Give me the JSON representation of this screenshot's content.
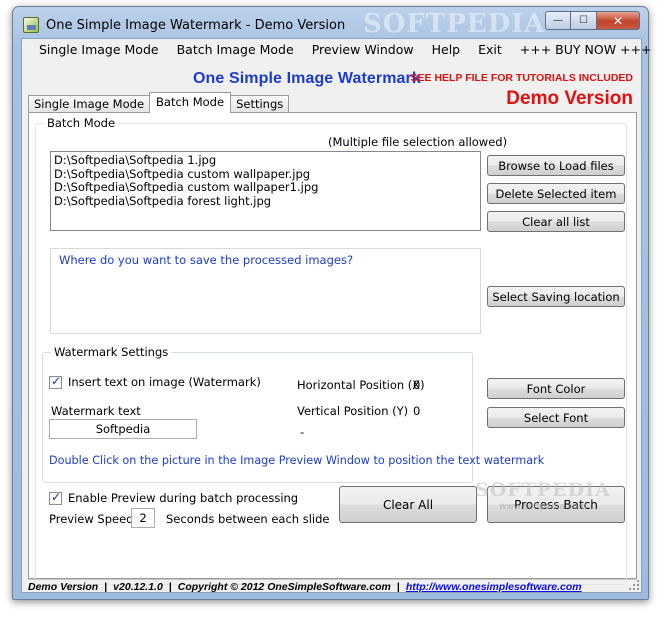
{
  "window": {
    "title": "One Simple Image Watermark - Demo Version",
    "title_watermark": "SOFTPEDIA",
    "minimize_glyph": "—",
    "maximize_glyph": "☐",
    "close_glyph": "✕"
  },
  "menu": {
    "items": [
      "Single Image Mode",
      "Batch Image Mode",
      "Preview Window",
      "Help",
      "Exit",
      "+++ BUY NOW +++"
    ]
  },
  "header": {
    "app_title": "One Simple Image Watermark",
    "help_note": "SEE HELP FILE FOR TUTORIALS INCLUDED",
    "demo_label": "Demo Version"
  },
  "tabs": [
    "Single Image Mode",
    "Batch Mode",
    "Settings"
  ],
  "active_tab": "Batch Mode",
  "batch": {
    "group_title": "Batch Mode",
    "multi_note": "(Multiple file selection allowed)",
    "files": [
      "D:\\Softpedia\\Softpedia 1.jpg",
      "D:\\Softpedia\\Softpedia custom wallpaper.jpg",
      "D:\\Softpedia\\Softpedia custom wallpaper1.jpg",
      "D:\\Softpedia\\Softpedia forest light.jpg"
    ],
    "browse_label": "Browse to Load files",
    "delete_label": "Delete Selected item",
    "clear_list_label": "Clear all list",
    "save_prompt": "Where do you want to save the processed images?",
    "select_saving_label": "Select Saving location"
  },
  "watermark": {
    "group_title": "Watermark Settings",
    "insert_text_label": "Insert text on image (Watermark)",
    "insert_text_checked": true,
    "watermark_text_label": "Watermark text",
    "watermark_text_value": "Softpedia",
    "horizontal_label": "Horizontal Position (X)",
    "horizontal_value": "0",
    "vertical_label": "Vertical Position (Y)",
    "vertical_value": "0",
    "dash": "-",
    "font_color_label": "Font Color",
    "select_font_label": "Select Font",
    "dblclick_hint": "Double Click on the picture in the Image Preview Window to position the text watermark"
  },
  "preview": {
    "enable_label": "Enable Preview during batch processing",
    "enable_checked": true,
    "speed_label": "Preview Speed",
    "speed_value": "2",
    "speed_unit": "Seconds between each slide"
  },
  "actions": {
    "clear_all_label": "Clear All",
    "process_batch_label": "Process Batch"
  },
  "overlay": {
    "softpedia": "SOFTPEDIA",
    "softpedia_url": "www.softpedia.com"
  },
  "status": {
    "edition": "Demo Version",
    "version": "v20.12.1.0",
    "copyright": "Copyright © 2012 OneSimpleSoftware.com",
    "link": "http://www.onesimplesoftware.com",
    "sep": "|"
  },
  "colors": {
    "accent_blue": "#1c3bd0",
    "alert_red": "#e01010",
    "link_blue": "#0a0aee"
  }
}
